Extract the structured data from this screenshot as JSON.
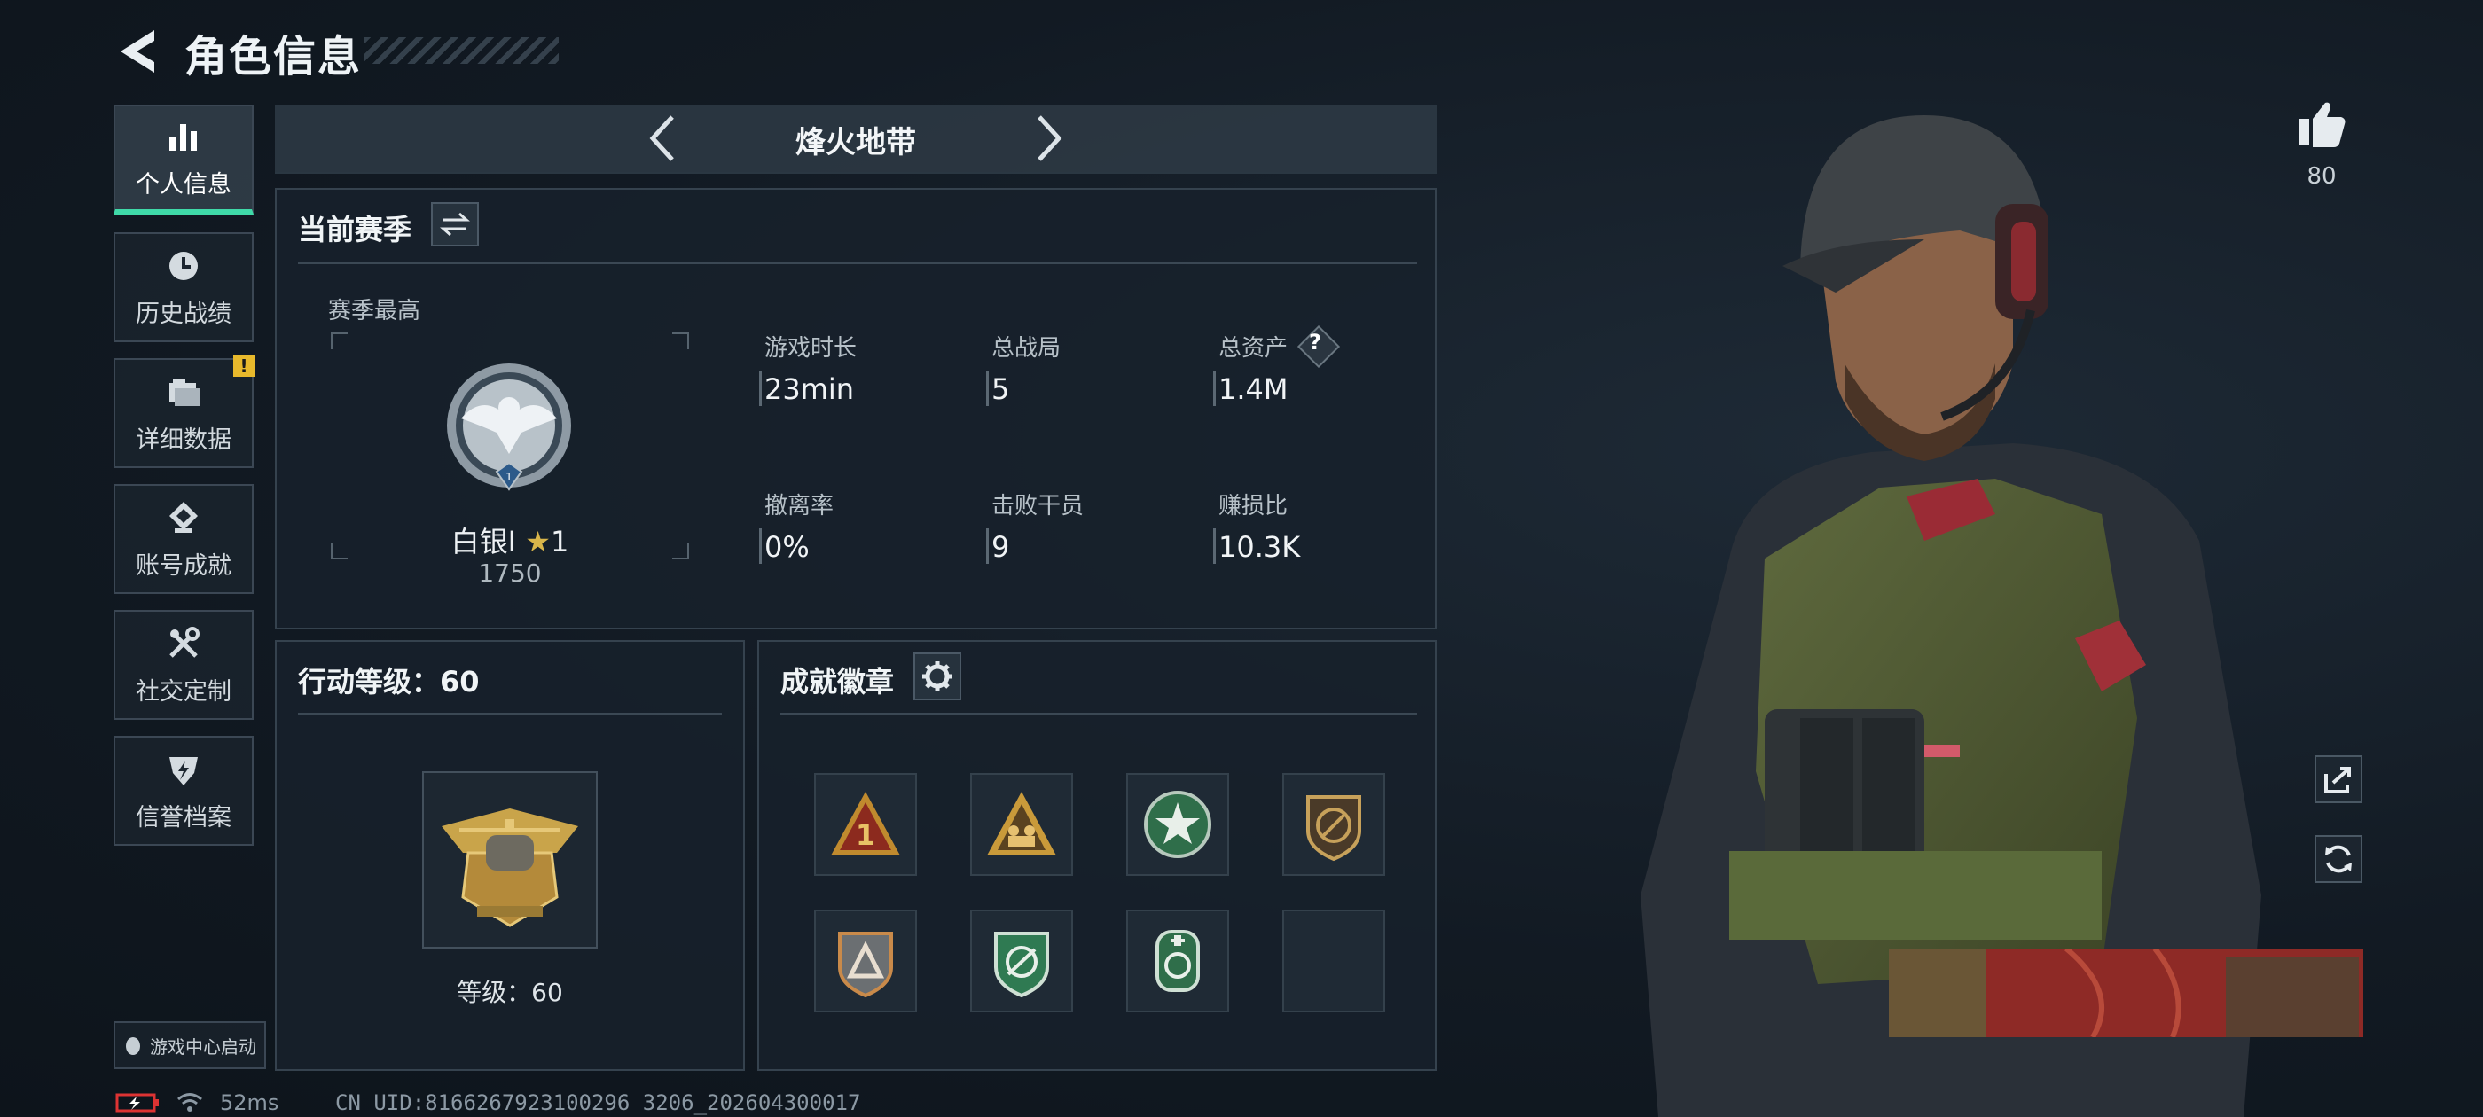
{
  "header": {
    "title": "角色信息",
    "back_icon": "back-arrow-icon"
  },
  "nav": {
    "items": [
      {
        "label": "个人信息",
        "icon": "bar-chart-icon",
        "active": true
      },
      {
        "label": "历史战绩",
        "icon": "clock-icon",
        "active": false
      },
      {
        "label": "详细数据",
        "icon": "folder-icon",
        "active": false,
        "badge": "!"
      },
      {
        "label": "账号成就",
        "icon": "achievement-icon",
        "active": false
      },
      {
        "label": "社交定制",
        "icon": "tools-icon",
        "active": false
      },
      {
        "label": "信誉档案",
        "icon": "shield-bolt-icon",
        "active": false
      }
    ],
    "launch_label": "游戏中心启动"
  },
  "mode": {
    "name": "烽火地带"
  },
  "season": {
    "title": "当前赛季",
    "best_label": "赛季最高",
    "rank_name": "白银I",
    "rank_stars": "1",
    "rank_points": "1750",
    "stats": [
      {
        "label": "游戏时长",
        "value": "23min"
      },
      {
        "label": "总战局",
        "value": "5"
      },
      {
        "label": "总资产",
        "value": "1.4M",
        "help": "?"
      },
      {
        "label": "撤离率",
        "value": "0%"
      },
      {
        "label": "击败干员",
        "value": "9"
      },
      {
        "label": "赚损比",
        "value": "10.3K"
      }
    ]
  },
  "action_level": {
    "title": "行动等级：60",
    "level_text": "等级：60"
  },
  "badges": {
    "title": "成就徽章",
    "slots": [
      {
        "icon": "rank-one-triangle-badge"
      },
      {
        "icon": "squad-triangle-badge"
      },
      {
        "icon": "green-star-badge"
      },
      {
        "icon": "no-weapon-badge"
      },
      {
        "icon": "grey-triangle-badge"
      },
      {
        "icon": "green-scope-badge"
      },
      {
        "icon": "green-medic-badge"
      },
      {
        "icon": "empty-slot"
      }
    ]
  },
  "likes": {
    "count": "80"
  },
  "status": {
    "ping": "52ms",
    "uid": "CN UID:8166267923100296 3206_202604300017"
  },
  "colors": {
    "accent": "#3fd9a8",
    "badge_yellow": "#e8b92c",
    "gold": "#c9a44a"
  }
}
